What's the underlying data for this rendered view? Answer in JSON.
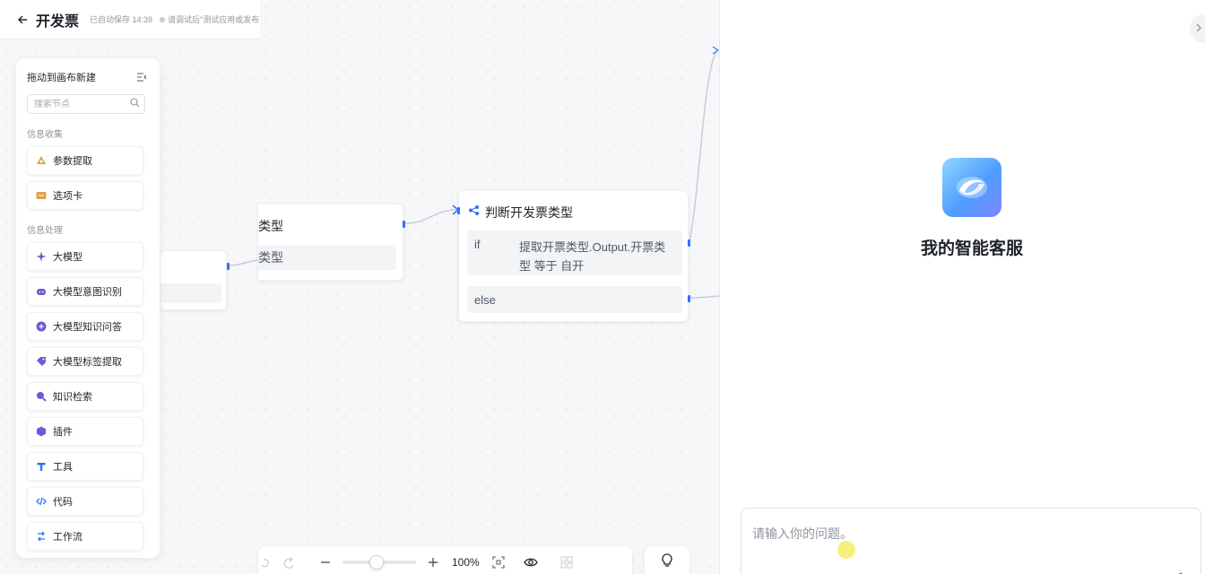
{
  "topbar": {
    "title": "开发票",
    "save_status": "已自动保存 14:39",
    "hint": "请调试后\"测试应用或发布"
  },
  "palette": {
    "title": "拖动到画布新建",
    "search_placeholder": "搜索节点",
    "sections": [
      {
        "title": "信息收集",
        "items": [
          {
            "label": "参数提取",
            "icon": "parameter-extract-icon",
            "color": "#e0a04a"
          },
          {
            "label": "选项卡",
            "icon": "option-card-icon",
            "color": "#e0a04a"
          }
        ]
      },
      {
        "title": "信息处理",
        "items": [
          {
            "label": "大模型",
            "icon": "llm-sparkle-icon",
            "color": "#6b5bd6"
          },
          {
            "label": "大模型意图识别",
            "icon": "intent-robot-icon",
            "color": "#6b5bd6"
          },
          {
            "label": "大模型知识问答",
            "icon": "knowledge-qa-icon",
            "color": "#6b5bd6"
          },
          {
            "label": "大模型标签提取",
            "icon": "tag-extract-icon",
            "color": "#6b5bd6"
          },
          {
            "label": "知识检索",
            "icon": "knowledge-search-icon",
            "color": "#6b5bd6"
          },
          {
            "label": "插件",
            "icon": "plugin-icon",
            "color": "#6b5bd6"
          },
          {
            "label": "工具",
            "icon": "tool-icon",
            "color": "#3370ff"
          },
          {
            "label": "代码",
            "icon": "code-icon",
            "color": "#3370ff"
          },
          {
            "label": "工作流",
            "icon": "workflow-icon",
            "color": "#3370ff"
          }
        ]
      }
    ]
  },
  "canvas": {
    "node_b": {
      "title_fragment": "类型",
      "row_fragment": "类型"
    },
    "node_c": {
      "title": "判断开发票类型",
      "if_label": "if",
      "condition": "提取开票类型.Output.开票类型 等于 自开",
      "else_label": "else"
    }
  },
  "toolbar": {
    "zoom_value": "100%",
    "zoom_level": 1.0
  },
  "preview": {
    "bot_name": "我的智能客服",
    "input_placeholder": "请输入你的问题。"
  },
  "colors": {
    "accent": "#3370ff",
    "edge": "#c9cdd4"
  }
}
